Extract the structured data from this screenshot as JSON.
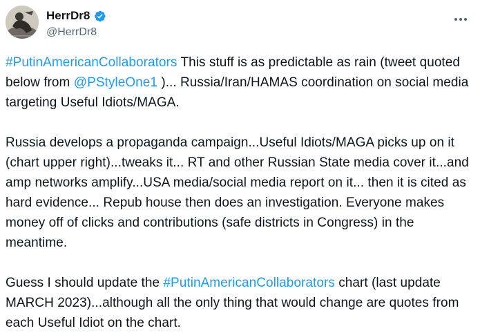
{
  "author": {
    "display_name": "HerrDr8",
    "handle": "@HerrDr8",
    "verified": true
  },
  "menu": {
    "icon": "more-horizontal-icon"
  },
  "paragraph1": {
    "hashtag": "#PutinAmericanCollaborators",
    "text_a": " This stuff is as predictable as rain (tweet quoted below from ",
    "mention": "@PStyleOne1",
    "text_b": " )... Russia/Iran/HAMAS coordination on social media targeting Useful Idiots/MAGA."
  },
  "paragraph2": {
    "text": "Russia develops a propaganda campaign...Useful Idiots/MAGA picks up on it (chart upper right)...tweaks it... RT and other Russian State media cover it...and amp networks amplify...USA media/social media report on it... then it is cited as hard evidence... Repub house then does an investigation. Everyone makes money off of clicks and contributions (safe districts in Congress) in the meantime."
  },
  "paragraph3": {
    "text_a": "Guess I should update the ",
    "hashtag": "#PutinAmericanCollaborators",
    "text_b": " chart (last update MARCH 2023)...although all the only thing that would change are quotes from each Useful Idiot on the chart."
  },
  "colors": {
    "link": "#1d9bf0",
    "verified": "#1d9bf0",
    "secondary_text": "#536471",
    "text": "#0f1419"
  }
}
